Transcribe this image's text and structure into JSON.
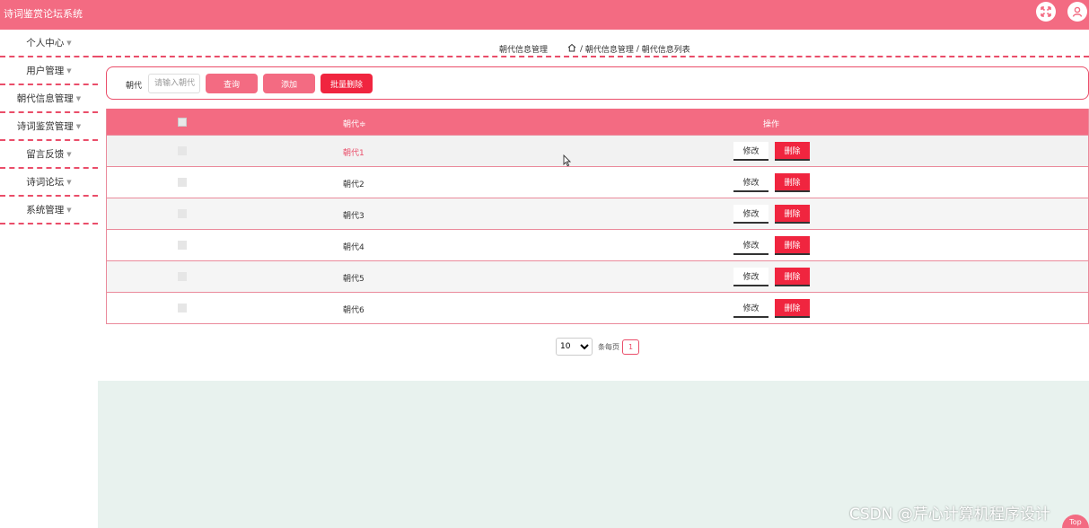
{
  "app": {
    "title": "诗词鉴赏论坛系统"
  },
  "header": {
    "fullscreen_icon": "fullscreen-icon",
    "user_icon": "user-icon"
  },
  "sidebar": {
    "items": [
      {
        "label": "个人中心"
      },
      {
        "label": "用户管理"
      },
      {
        "label": "朝代信息管理"
      },
      {
        "label": "诗词鉴赏管理"
      },
      {
        "label": "留言反馈"
      },
      {
        "label": "诗词论坛"
      },
      {
        "label": "系统管理"
      }
    ]
  },
  "breadcrumb": {
    "section": "朝代信息管理",
    "sep": "/",
    "level1": "朝代信息管理",
    "level2": "朝代信息列表"
  },
  "search": {
    "label": "朝代",
    "placeholder": "请输入朝代",
    "query_label": "查询",
    "add_label": "添加",
    "batch_delete_label": "批量删除"
  },
  "table": {
    "col_name": "朝代≑",
    "col_ops": "操作",
    "edit_label": "修改",
    "delete_label": "删除",
    "rows": [
      {
        "name": "朝代1"
      },
      {
        "name": "朝代2"
      },
      {
        "name": "朝代3"
      },
      {
        "name": "朝代4"
      },
      {
        "name": "朝代5"
      },
      {
        "name": "朝代6"
      }
    ]
  },
  "pagination": {
    "page_size": "10",
    "page_size_label": "条每页",
    "current_page": "1"
  },
  "watermark": "CSDN @芹心计算机程序设计",
  "back_to_top": "Top",
  "colors": {
    "primary": "#f36b82",
    "danger": "#f0253f",
    "border": "#ea4e6a",
    "bottom_bg": "#e8f2ee"
  }
}
